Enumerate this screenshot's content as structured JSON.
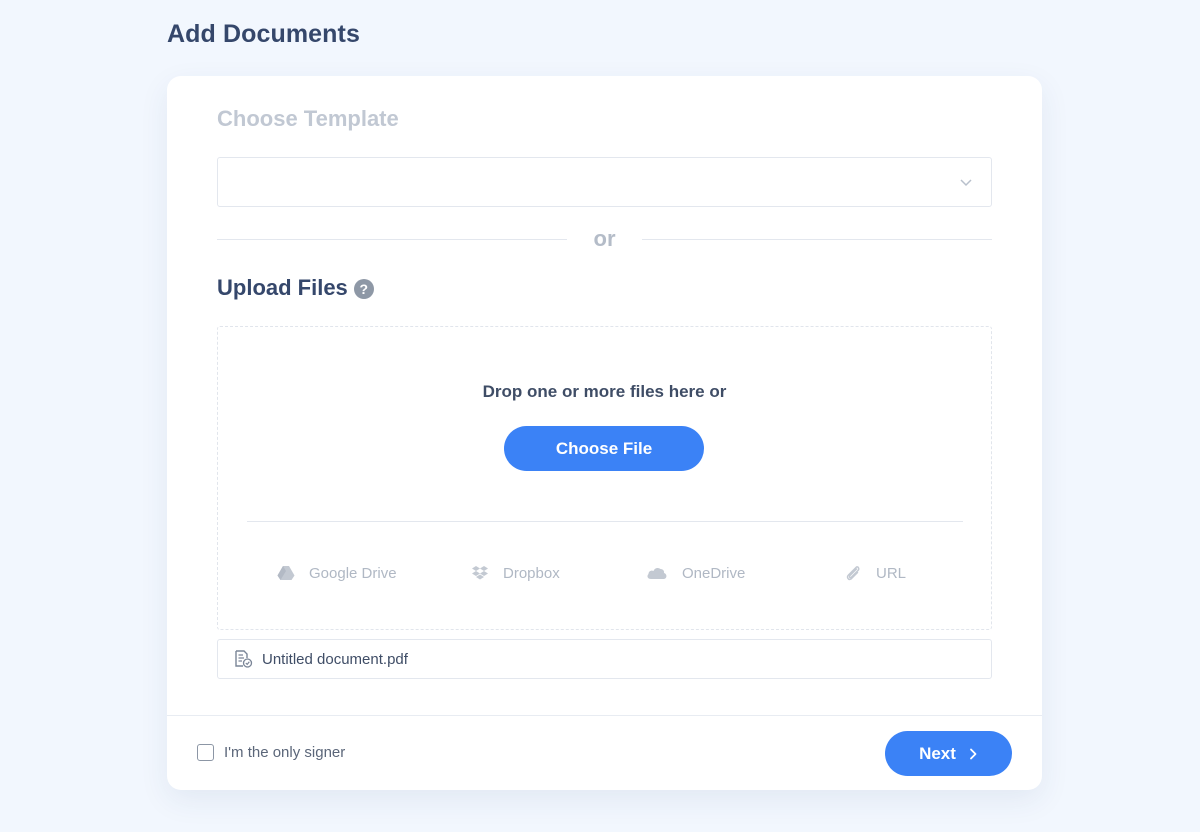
{
  "page": {
    "title": "Add Documents"
  },
  "template": {
    "title": "Choose Template",
    "selected_value": ""
  },
  "separator": {
    "text": "or"
  },
  "upload": {
    "title": "Upload Files",
    "help_icon": "?",
    "drop_text": "Drop one or more files here or",
    "choose_file_label": "Choose File",
    "sources": [
      {
        "label": "Google Drive",
        "icon": "google-drive-icon"
      },
      {
        "label": "Dropbox",
        "icon": "dropbox-icon"
      },
      {
        "label": "OneDrive",
        "icon": "onedrive-icon"
      },
      {
        "label": "URL",
        "icon": "paperclip-icon"
      }
    ]
  },
  "files": [
    {
      "name": "Untitled document.pdf",
      "icon": "document-icon"
    }
  ],
  "footer": {
    "only_signer_label": "I'm the only signer",
    "only_signer_checked": false,
    "next_label": "Next"
  },
  "colors": {
    "accent": "#3b82f6",
    "background": "#f2f7fe",
    "heading": "#35476b",
    "muted": "#c1c8d3"
  }
}
